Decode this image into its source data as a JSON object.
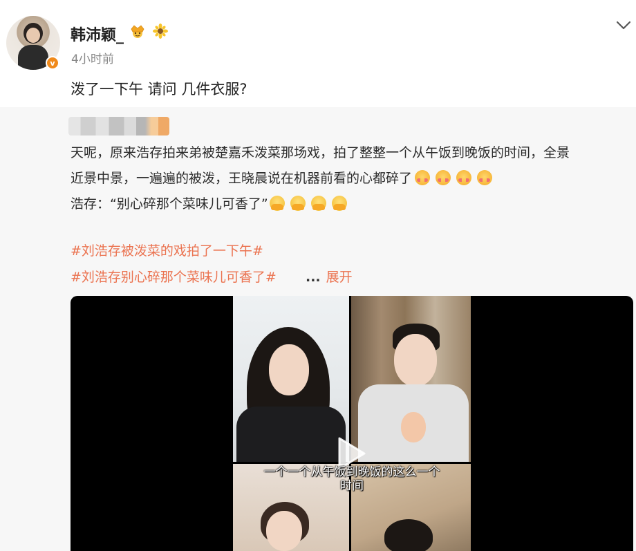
{
  "post": {
    "author": "韩沛颖_",
    "timestamp": "4小时前",
    "text": "泼了一下午 请问 几件衣服?",
    "badge_glyph": "v"
  },
  "repost": {
    "lines": [
      "天呢，原来浩存拍来弟被楚嘉禾泼菜那场戏，拍了整整一个从午饭到晚饭的时间，全景",
      "近景中景，一遍遍的被泼，王晓晨说在机器前看的心都碎了",
      "浩存：“别心碎那个菜味儿可香了”"
    ],
    "hashtags": [
      "#刘浩存被泼菜的戏拍了一下午#",
      "#刘浩存别心碎那个菜味儿可香了#"
    ],
    "expand_dots": "...",
    "expand_label": "展开"
  },
  "video": {
    "subtitle_line1": "一个一个从午饭到晚饭的这么一个",
    "subtitle_line2": "时间"
  },
  "icons": {
    "crown": "crown-emoji-icon",
    "sun": "sunflower-icon",
    "more": "chevron-down-icon",
    "play": "play-icon",
    "blush": "blush-face-emoji",
    "hands": "hands-over-mouth-emoji"
  },
  "colors": {
    "link": "#eb7350",
    "badge": "#f08a1b",
    "repost_bg": "#f7f7f7"
  }
}
